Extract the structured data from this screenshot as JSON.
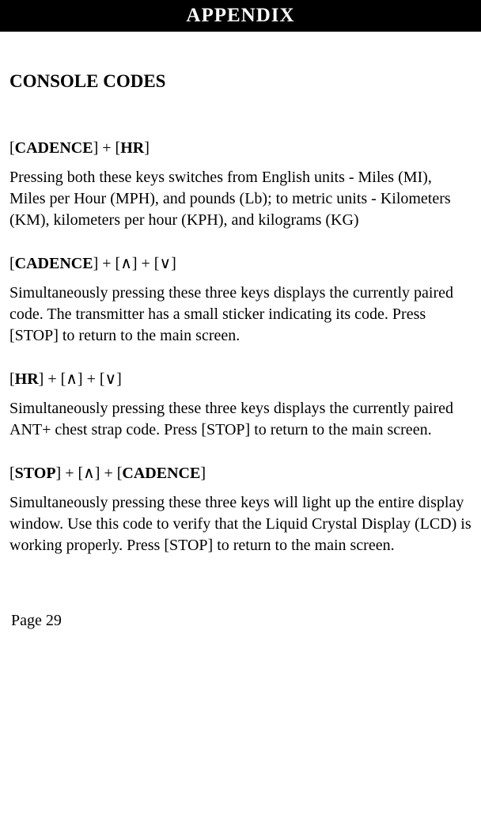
{
  "header": "APPENDIX",
  "section_title": "CONSOLE CODES",
  "entries": [
    {
      "heading_html": "[<b>CADENCE</b>] + [<b>HR</b>]",
      "body": "Pressing both these keys switches from English units - Miles (MI), Miles per Hour (MPH), and pounds (Lb); to metric units - Kilometers (KM), kilometers per hour (KPH), and kilograms (KG)"
    },
    {
      "heading_html": "[<b>CADENCE</b>] + [<span class='up'>∧</span>] + [<span class='up'>∨</span>]",
      "body": "Simultaneously pressing these three keys displays the cur­rently paired code.  The transmitter has a small sticker indi­cating its code.  Press [STOP] to return to the main screen."
    },
    {
      "heading_html": "[<b>HR</b>] + [<span class='up'>∧</span>] + [<span class='up'>∨</span>]",
      "body": "Simultaneously pressing these three keys displays the cur­rently paired ANT+ chest strap code.  Press [STOP] to return to the main screen."
    },
    {
      "heading_html": "[<b>STOP</b>] + [<span class='up'>∧</span>] + [<b>CADENCE</b>]",
      "body": "Simultaneously pressing these three keys will light up the en­tire display window.  Use this code to verify that the Liquid Crystal Display (LCD) is working properly.  Press [STOP] to return to the main screen."
    }
  ],
  "page_label": "Page 29"
}
